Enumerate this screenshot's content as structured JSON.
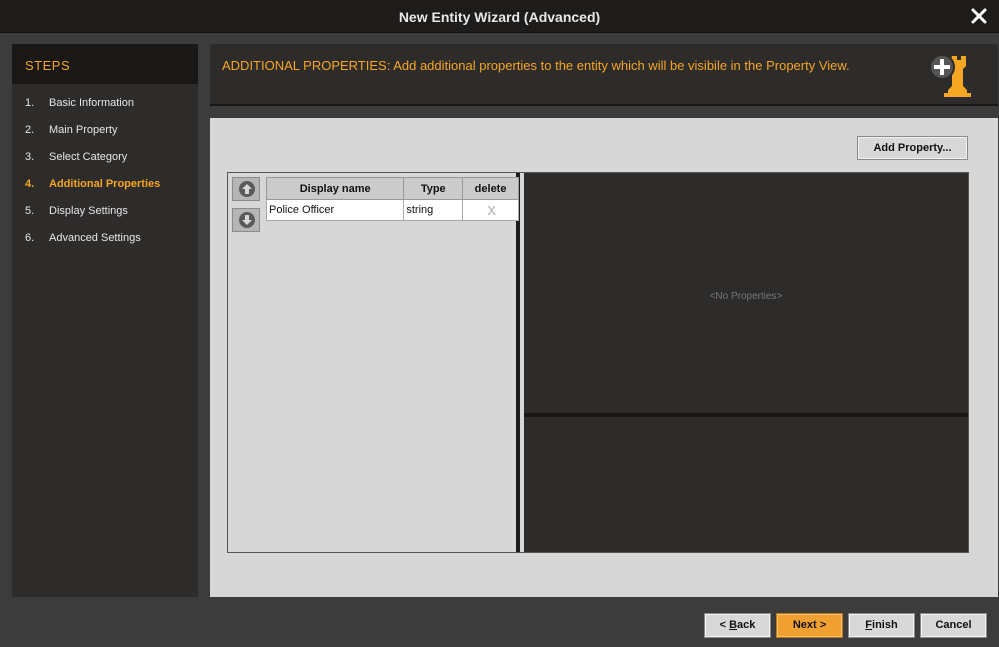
{
  "window": {
    "title": "New Entity Wizard (Advanced)"
  },
  "steps": {
    "header": "STEPS",
    "items": [
      {
        "num": "1.",
        "label": "Basic Information",
        "active": false
      },
      {
        "num": "2.",
        "label": "Main Property",
        "active": false
      },
      {
        "num": "3.",
        "label": "Select Category",
        "active": false
      },
      {
        "num": "4.",
        "label": "Additional Properties",
        "active": true
      },
      {
        "num": "5.",
        "label": "Display Settings",
        "active": false
      },
      {
        "num": "6.",
        "label": "Advanced Settings",
        "active": false
      }
    ]
  },
  "banner": {
    "text": "ADDITIONAL PROPERTIES: Add additional properties to the entity which will be visibile in the Property View.",
    "icon": "add-entity-rook-icon"
  },
  "content": {
    "add_property_label": "Add Property...",
    "table": {
      "headers": [
        "Display name",
        "Type",
        "delete"
      ],
      "rows": [
        {
          "display_name": "Police Officer",
          "type": "string",
          "delete": "X"
        }
      ]
    },
    "empty_text": "<No Properties>"
  },
  "footer": {
    "back_prefix": "< ",
    "back_key": "B",
    "back_rest": "ack",
    "next_label": "Next >",
    "finish_key": "F",
    "finish_rest": "inish",
    "cancel_label": "Cancel"
  },
  "colors": {
    "accent": "#f5a623",
    "panel": "#2e2b2b",
    "content_bg": "#d7d7d7"
  }
}
